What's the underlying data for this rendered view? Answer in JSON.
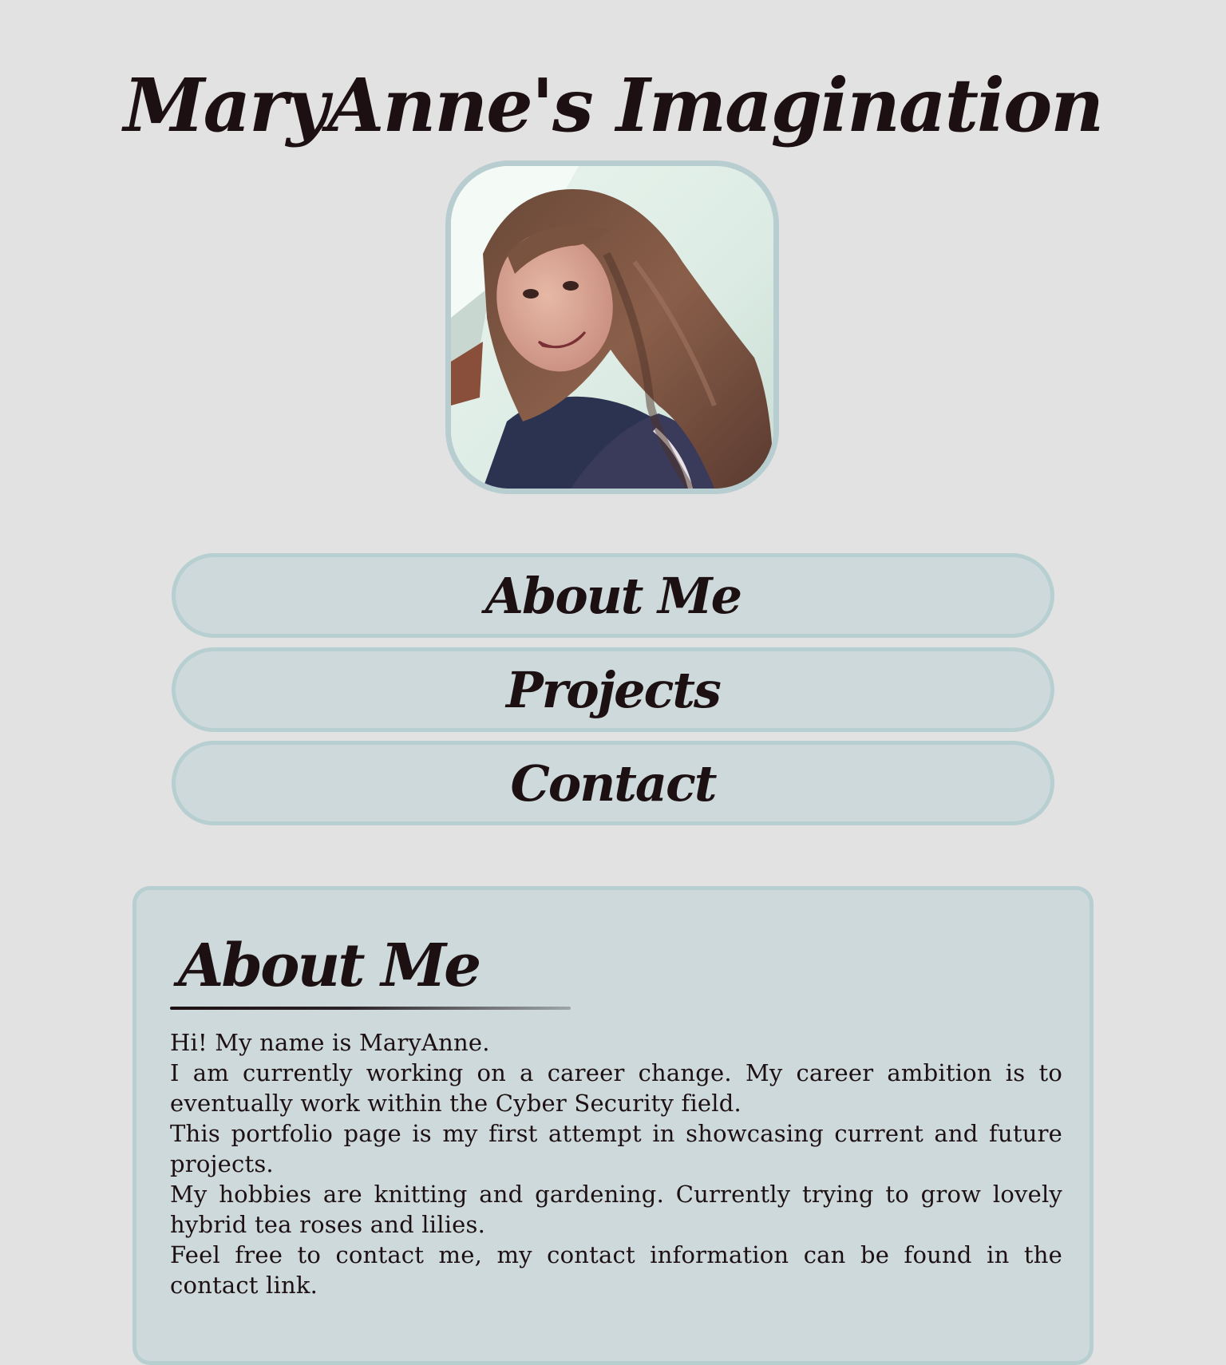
{
  "header": {
    "title": "MaryAnne's Imagination"
  },
  "avatar": {
    "alt": "profile-photo"
  },
  "nav": {
    "items": [
      {
        "label": "About Me"
      },
      {
        "label": "Projects"
      },
      {
        "label": "Contact"
      }
    ]
  },
  "about": {
    "heading": "About Me",
    "paragraphs": [
      "Hi! My name is MaryAnne.",
      "I am currently working on a career change. My career ambition is to eventually work within the Cyber Security field.",
      "This portfolio page is my first attempt in showcasing current and future projects.",
      "My hobbies are knitting and gardening. Currently trying to grow lovely hybrid tea roses and lilies.",
      "Feel free to contact me, my contact information can be found in the contact link."
    ]
  },
  "colors": {
    "background": "#e2e2e2",
    "panel": "#cdd9da",
    "border": "#b7cfd0",
    "text": "#1d1013"
  }
}
